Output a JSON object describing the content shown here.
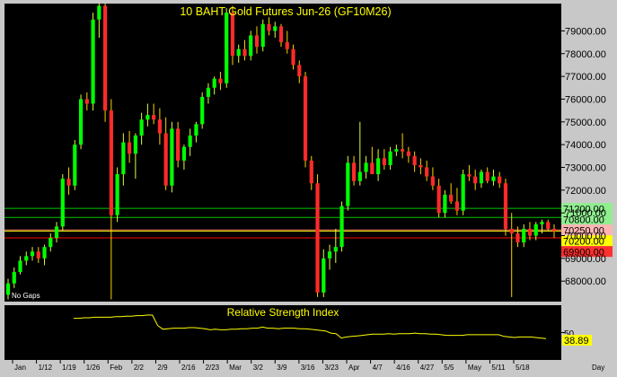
{
  "chart_data": {
    "type": "candlestick",
    "title": "10 BAHT Gold Futures Jun-26 (GF10M26)",
    "corner_label": "No Gaps",
    "period_label": "Day",
    "y_ticks": [
      68000,
      69000,
      70000,
      71000,
      72000,
      73000,
      74000,
      75000,
      76000,
      77000,
      78000,
      79000
    ],
    "y_tick_labels": [
      "68000.00",
      "69000.00",
      "70000.00",
      "71000.00",
      "72000.00",
      "73000.00",
      "74000.00",
      "75000.00",
      "76000.00",
      "77000.00",
      "78000.00",
      "79000.00"
    ],
    "ylim": [
      67100,
      80200
    ],
    "x_date_labels": [
      "Jan",
      "1/12",
      "1/19",
      "1/26",
      "Feb",
      "2/2",
      "2/9",
      "2/16",
      "2/23",
      "Mar",
      "3/2",
      "3/9",
      "3/16",
      "3/23",
      "Apr",
      "4/7",
      "4/16",
      "4/27",
      "5/5",
      "May",
      "5/11",
      "5/18"
    ],
    "levels": [
      {
        "value": 71200,
        "label": "71200.00",
        "color": "#00c800",
        "label_bg": "#90ee90"
      },
      {
        "value": 70800,
        "label": "70800.00",
        "color": "#00c800",
        "label_bg": "#90ee90"
      },
      {
        "value": 70250,
        "label": "70250.00",
        "color": "#e06060",
        "label_bg": "#ffb4b4"
      },
      {
        "value": 70200,
        "label": "70200.00",
        "color": "#ffff00",
        "label_bg": "#ffff00"
      },
      {
        "value": 69900,
        "label": "69900.00",
        "color": "#ff0000",
        "label_bg": "#ff3030"
      }
    ],
    "candles": [
      {
        "o": 67400,
        "h": 68100,
        "l": 67200,
        "c": 67900
      },
      {
        "o": 67900,
        "h": 68600,
        "l": 67700,
        "c": 68400
      },
      {
        "o": 68400,
        "h": 69100,
        "l": 68300,
        "c": 68900
      },
      {
        "o": 68900,
        "h": 69300,
        "l": 68700,
        "c": 69100
      },
      {
        "o": 69100,
        "h": 69500,
        "l": 68900,
        "c": 69300
      },
      {
        "o": 69300,
        "h": 69500,
        "l": 68800,
        "c": 69000
      },
      {
        "o": 69000,
        "h": 69600,
        "l": 68700,
        "c": 69500
      },
      {
        "o": 69500,
        "h": 70100,
        "l": 69300,
        "c": 69900
      },
      {
        "o": 69900,
        "h": 70600,
        "l": 69700,
        "c": 70400
      },
      {
        "o": 70400,
        "h": 72700,
        "l": 70200,
        "c": 72500
      },
      {
        "o": 72500,
        "h": 73000,
        "l": 71800,
        "c": 72200
      },
      {
        "o": 72200,
        "h": 74200,
        "l": 72000,
        "c": 74000
      },
      {
        "o": 74000,
        "h": 76200,
        "l": 73800,
        "c": 76000
      },
      {
        "o": 76000,
        "h": 76300,
        "l": 75500,
        "c": 75800
      },
      {
        "o": 75800,
        "h": 79800,
        "l": 75500,
        "c": 79500
      },
      {
        "o": 79500,
        "h": 80200,
        "l": 78700,
        "c": 80100
      },
      {
        "o": 80100,
        "h": 80200,
        "l": 75000,
        "c": 75500
      },
      {
        "o": 75500,
        "h": 76000,
        "l": 67200,
        "c": 70900
      },
      {
        "o": 70900,
        "h": 73000,
        "l": 70600,
        "c": 72700
      },
      {
        "o": 72700,
        "h": 74500,
        "l": 72200,
        "c": 74100
      },
      {
        "o": 74100,
        "h": 74600,
        "l": 73200,
        "c": 73600
      },
      {
        "o": 73600,
        "h": 74500,
        "l": 72500,
        "c": 74400
      },
      {
        "o": 74400,
        "h": 75400,
        "l": 74000,
        "c": 75100
      },
      {
        "o": 75100,
        "h": 75800,
        "l": 74800,
        "c": 75300
      },
      {
        "o": 75300,
        "h": 75800,
        "l": 74900,
        "c": 75100
      },
      {
        "o": 75100,
        "h": 75600,
        "l": 74000,
        "c": 74500
      },
      {
        "o": 74500,
        "h": 75200,
        "l": 72000,
        "c": 72200
      },
      {
        "o": 72200,
        "h": 75000,
        "l": 71900,
        "c": 74700
      },
      {
        "o": 74700,
        "h": 75000,
        "l": 73000,
        "c": 73300
      },
      {
        "o": 73300,
        "h": 74000,
        "l": 72900,
        "c": 73900
      },
      {
        "o": 73900,
        "h": 74700,
        "l": 73500,
        "c": 74400
      },
      {
        "o": 74400,
        "h": 75000,
        "l": 74100,
        "c": 74900
      },
      {
        "o": 74900,
        "h": 76300,
        "l": 74700,
        "c": 76100
      },
      {
        "o": 76100,
        "h": 76700,
        "l": 75800,
        "c": 76500
      },
      {
        "o": 76500,
        "h": 77000,
        "l": 76200,
        "c": 76900
      },
      {
        "o": 76900,
        "h": 77200,
        "l": 76400,
        "c": 76700
      },
      {
        "o": 76700,
        "h": 80000,
        "l": 76500,
        "c": 79800
      },
      {
        "o": 79800,
        "h": 80100,
        "l": 77500,
        "c": 77900
      },
      {
        "o": 77900,
        "h": 78400,
        "l": 77600,
        "c": 78200
      },
      {
        "o": 78200,
        "h": 78600,
        "l": 77700,
        "c": 77900
      },
      {
        "o": 77900,
        "h": 79000,
        "l": 77700,
        "c": 78800
      },
      {
        "o": 78800,
        "h": 79200,
        "l": 78000,
        "c": 78300
      },
      {
        "o": 78300,
        "h": 79500,
        "l": 78100,
        "c": 79300
      },
      {
        "o": 79300,
        "h": 79600,
        "l": 78800,
        "c": 79000
      },
      {
        "o": 79000,
        "h": 79400,
        "l": 78700,
        "c": 79200
      },
      {
        "o": 79200,
        "h": 79300,
        "l": 78300,
        "c": 78500
      },
      {
        "o": 78500,
        "h": 79000,
        "l": 78000,
        "c": 78200
      },
      {
        "o": 78200,
        "h": 78400,
        "l": 77300,
        "c": 77500
      },
      {
        "o": 77500,
        "h": 77700,
        "l": 76700,
        "c": 77000
      },
      {
        "o": 77000,
        "h": 77200,
        "l": 73000,
        "c": 73300
      },
      {
        "o": 73300,
        "h": 73500,
        "l": 72000,
        "c": 72300
      },
      {
        "o": 72300,
        "h": 72700,
        "l": 67300,
        "c": 67500
      },
      {
        "o": 67500,
        "h": 69400,
        "l": 67300,
        "c": 69000
      },
      {
        "o": 69000,
        "h": 69600,
        "l": 68500,
        "c": 69300
      },
      {
        "o": 69300,
        "h": 70300,
        "l": 68800,
        "c": 69500
      },
      {
        "o": 69500,
        "h": 71500,
        "l": 69300,
        "c": 71300
      },
      {
        "o": 71300,
        "h": 73500,
        "l": 71100,
        "c": 73200
      },
      {
        "o": 73200,
        "h": 73500,
        "l": 72200,
        "c": 72400
      },
      {
        "o": 72400,
        "h": 75000,
        "l": 72200,
        "c": 72800
      },
      {
        "o": 72800,
        "h": 73500,
        "l": 72500,
        "c": 73200
      },
      {
        "o": 73200,
        "h": 73900,
        "l": 72900,
        "c": 72700
      },
      {
        "o": 72700,
        "h": 73800,
        "l": 72400,
        "c": 73400
      },
      {
        "o": 73400,
        "h": 73800,
        "l": 72900,
        "c": 73100
      },
      {
        "o": 73100,
        "h": 73900,
        "l": 72900,
        "c": 73700
      },
      {
        "o": 73700,
        "h": 74000,
        "l": 73500,
        "c": 73800
      },
      {
        "o": 73800,
        "h": 74500,
        "l": 73400,
        "c": 73700
      },
      {
        "o": 73700,
        "h": 73900,
        "l": 73200,
        "c": 73500
      },
      {
        "o": 73500,
        "h": 73700,
        "l": 72800,
        "c": 73100
      },
      {
        "o": 73100,
        "h": 73400,
        "l": 72700,
        "c": 73000
      },
      {
        "o": 73000,
        "h": 73300,
        "l": 72400,
        "c": 72600
      },
      {
        "o": 72600,
        "h": 73000,
        "l": 72000,
        "c": 72200
      },
      {
        "o": 72200,
        "h": 72500,
        "l": 70800,
        "c": 71000
      },
      {
        "o": 71000,
        "h": 72000,
        "l": 70800,
        "c": 71800
      },
      {
        "o": 71800,
        "h": 72300,
        "l": 71400,
        "c": 71500
      },
      {
        "o": 71500,
        "h": 72100,
        "l": 70900,
        "c": 71100
      },
      {
        "o": 71100,
        "h": 72900,
        "l": 70900,
        "c": 72700
      },
      {
        "o": 72700,
        "h": 73100,
        "l": 72400,
        "c": 72600
      },
      {
        "o": 72600,
        "h": 72900,
        "l": 72000,
        "c": 72300
      },
      {
        "o": 72300,
        "h": 72900,
        "l": 72100,
        "c": 72800
      },
      {
        "o": 72800,
        "h": 73000,
        "l": 72300,
        "c": 72400
      },
      {
        "o": 72400,
        "h": 72900,
        "l": 72200,
        "c": 72600
      },
      {
        "o": 72600,
        "h": 72800,
        "l": 72100,
        "c": 72300
      },
      {
        "o": 72300,
        "h": 72500,
        "l": 70000,
        "c": 70300
      },
      {
        "o": 70300,
        "h": 71000,
        "l": 67300,
        "c": 70100
      },
      {
        "o": 70100,
        "h": 70400,
        "l": 69500,
        "c": 69700
      },
      {
        "o": 69700,
        "h": 70500,
        "l": 69500,
        "c": 70300
      },
      {
        "o": 70300,
        "h": 70600,
        "l": 69800,
        "c": 70000
      },
      {
        "o": 70000,
        "h": 70600,
        "l": 69800,
        "c": 70500
      },
      {
        "o": 70500,
        "h": 70700,
        "l": 70100,
        "c": 70600
      },
      {
        "o": 70600,
        "h": 70700,
        "l": 70200,
        "c": 70300
      },
      {
        "o": 70300,
        "h": 70500,
        "l": 69900,
        "c": 70200
      }
    ],
    "rsi": {
      "title": "Relative Strength Index",
      "value_label": "38.89",
      "tick_label": "50",
      "ylim": [
        0,
        100
      ],
      "values": [
        76,
        76,
        77,
        77,
        78,
        78,
        78,
        78,
        79,
        79,
        80,
        80,
        81,
        81,
        82,
        82,
        63,
        56,
        57,
        58,
        58,
        58,
        59,
        59,
        58,
        57,
        55,
        56,
        55,
        55,
        56,
        56,
        57,
        57,
        58,
        58,
        60,
        58,
        58,
        57,
        58,
        58,
        58,
        57,
        57,
        56,
        55,
        54,
        53,
        49,
        48,
        40,
        42,
        43,
        44,
        45,
        46,
        47,
        47,
        47,
        48,
        47,
        48,
        48,
        48,
        49,
        48,
        48,
        47,
        47,
        46,
        45,
        45,
        45,
        45,
        46,
        46,
        46,
        46,
        46,
        46,
        46,
        43,
        42,
        41,
        42,
        42,
        42,
        41,
        40,
        39
      ]
    }
  }
}
